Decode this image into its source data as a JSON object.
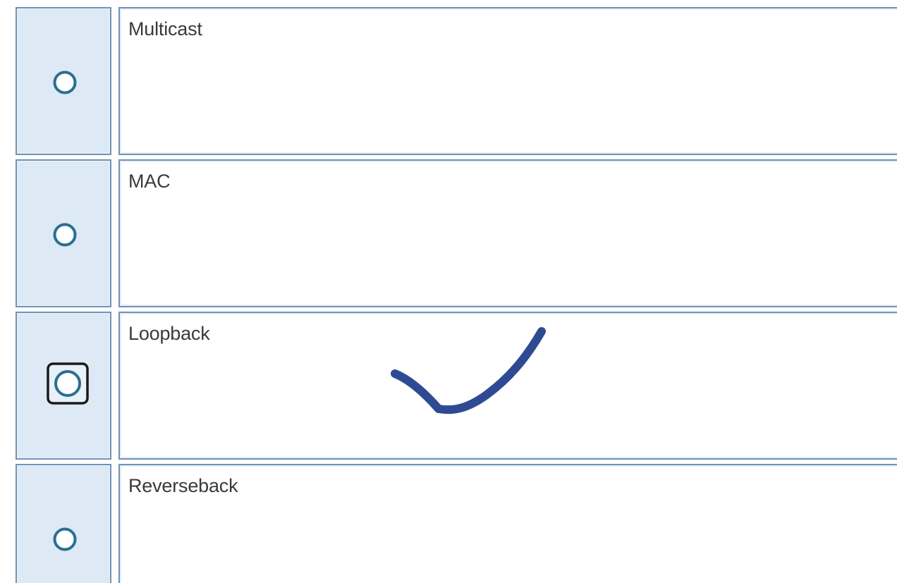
{
  "options": [
    {
      "label": "Multicast",
      "selected": false
    },
    {
      "label": "MAC",
      "selected": false
    },
    {
      "label": "Loopback",
      "selected": true
    },
    {
      "label": "Reverseback",
      "selected": false
    }
  ],
  "colors": {
    "radio_ring": "#2a6f8f",
    "cell_border": "#6f93b6",
    "radio_cell_bg": "#dde9f5",
    "annotation_ink": "#2e4a93"
  },
  "icons": {
    "radio": "radio-button-icon",
    "annotation": "checkmark-icon"
  }
}
